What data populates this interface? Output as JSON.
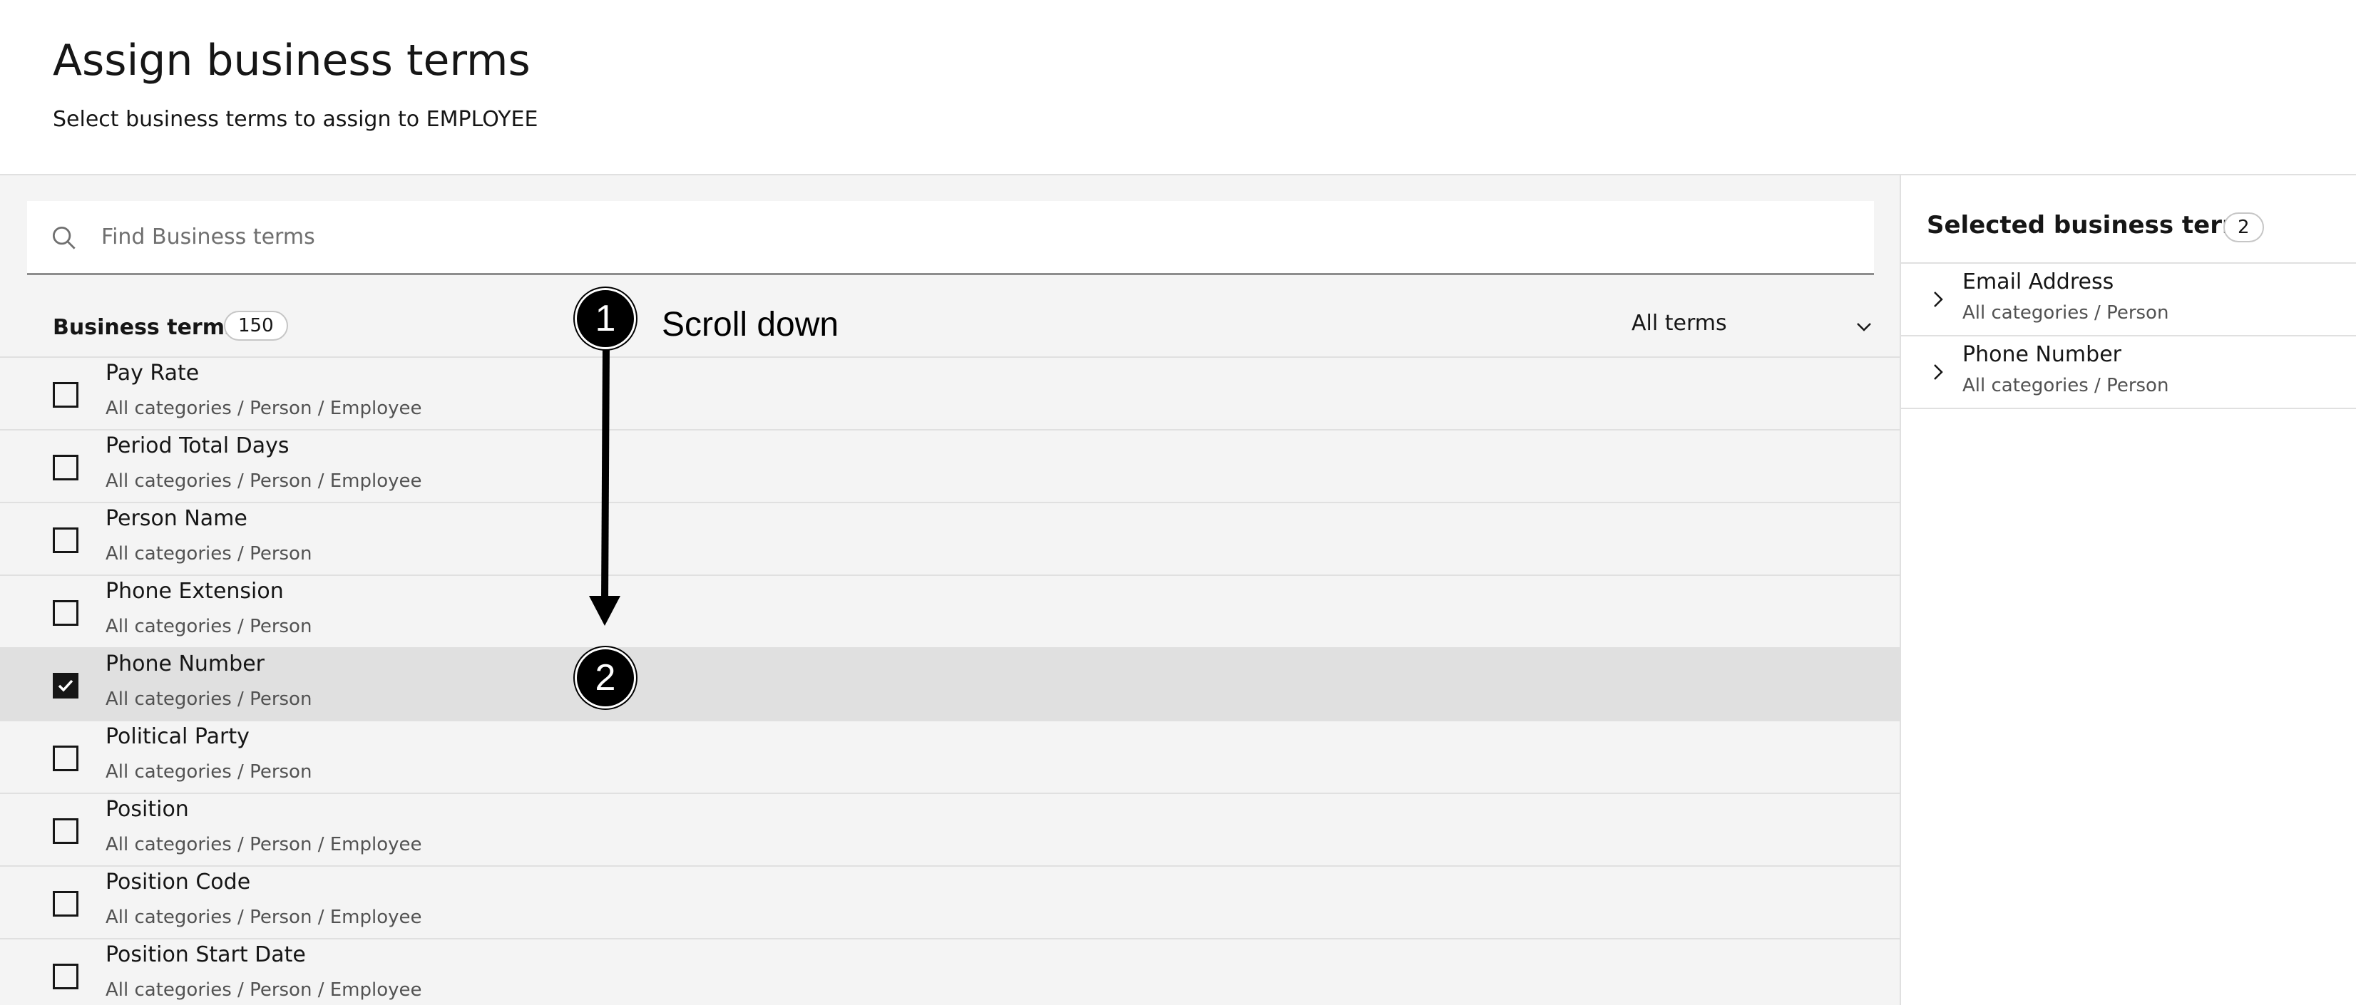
{
  "header": {
    "title": "Assign business terms",
    "subtitle": "Select business terms to assign to EMPLOYEE"
  },
  "search": {
    "placeholder": "Find Business terms"
  },
  "list": {
    "title": "Business terms",
    "count": "150",
    "filter_label": "All terms",
    "rows": [
      {
        "name": "Pay Rate",
        "path": "All categories  /  Person  /  Employee",
        "checked": false
      },
      {
        "name": "Period Total Days",
        "path": "All categories  /  Person  /  Employee",
        "checked": false
      },
      {
        "name": "Person Name",
        "path": "All categories  /  Person",
        "checked": false
      },
      {
        "name": "Phone Extension",
        "path": "All categories  /  Person",
        "checked": false
      },
      {
        "name": "Phone Number",
        "path": "All categories  /  Person",
        "checked": true
      },
      {
        "name": "Political Party",
        "path": "All categories  /  Person",
        "checked": false
      },
      {
        "name": "Position",
        "path": "All categories  /  Person  /  Employee",
        "checked": false
      },
      {
        "name": "Position Code",
        "path": "All categories  /  Person  /  Employee",
        "checked": false
      },
      {
        "name": "Position Start Date",
        "path": "All categories  /  Person  /  Employee",
        "checked": false
      }
    ]
  },
  "selected": {
    "title": "Selected business terms",
    "count": "2",
    "items": [
      {
        "name": "Email Address",
        "path": "All categories  /  Person"
      },
      {
        "name": "Phone Number",
        "path": "All categories  /  Person"
      }
    ]
  },
  "annotations": {
    "step1": "1",
    "step1_text": "Scroll down",
    "step2": "2"
  },
  "colors": {
    "selected_row": "#e0e0e0",
    "panel_bg": "#f4f4f4",
    "text_primary": "#161616",
    "text_secondary": "#525252"
  }
}
